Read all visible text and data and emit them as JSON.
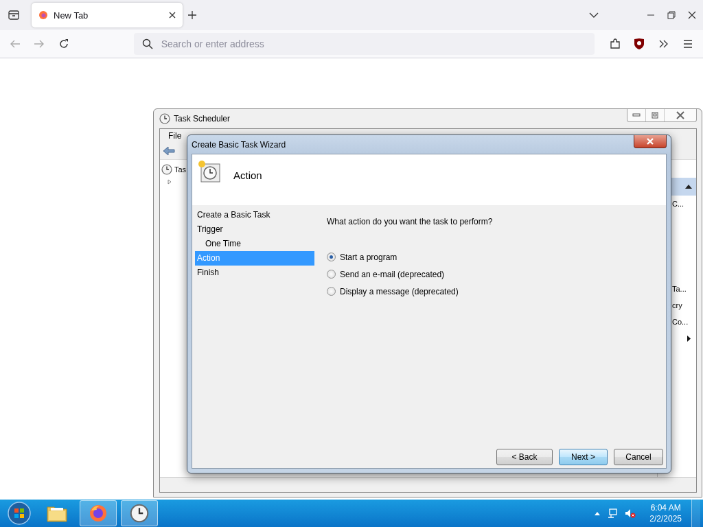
{
  "browser": {
    "tabs": [
      {
        "title": "New Tab",
        "selected": true
      }
    ],
    "address_bar": {
      "placeholder": "Search or enter address"
    }
  },
  "task_scheduler": {
    "title": "Task Scheduler",
    "menu": [
      "File"
    ],
    "tree": [
      {
        "label": "Tas",
        "expanded": false
      }
    ],
    "right_pane": [
      "C...",
      "Ta...",
      "cry",
      "Co..."
    ]
  },
  "wizard": {
    "title": "Create Basic Task Wizard",
    "heading": "Action",
    "steps": [
      {
        "label": "Create a Basic Task",
        "selected": false
      },
      {
        "label": "Trigger",
        "selected": false,
        "children": [
          {
            "label": "One Time",
            "selected": false
          }
        ]
      },
      {
        "label": "Action",
        "selected": true
      },
      {
        "label": "Finish",
        "selected": false
      }
    ],
    "question": "What action do you want the task to perform?",
    "options": [
      {
        "label": "Start a program",
        "selected": true
      },
      {
        "label": "Send an e-mail (deprecated)",
        "selected": false
      },
      {
        "label": "Display a message (deprecated)",
        "selected": false
      }
    ],
    "buttons": [
      {
        "label": "< Back",
        "default": false
      },
      {
        "label": "Next >",
        "default": true
      },
      {
        "label": "Cancel",
        "default": false
      }
    ]
  },
  "taskbar": {
    "apps": [
      {
        "kind": "explorer",
        "running": false
      },
      {
        "kind": "firefox",
        "running": true
      },
      {
        "kind": "clock",
        "running": true
      }
    ],
    "clock": {
      "time": "6:04 AM",
      "date": "2/2/2025"
    }
  }
}
